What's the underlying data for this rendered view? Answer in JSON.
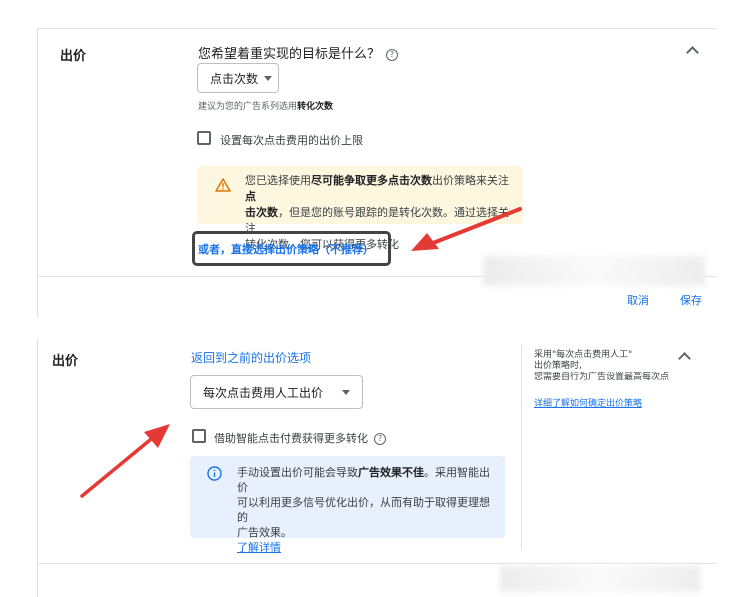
{
  "top": {
    "section_title": "出价",
    "question": "您希望着重实现的目标是什么？",
    "dropdown_value": "点击次数",
    "hint_prefix": "建议为您的广告系列选用",
    "hint_bold": "转化次数",
    "checkbox_label": "设置每次点击费用的出价上限",
    "warning_line1_a": "您已选择使用",
    "warning_line1_b": "尽可能争取更多点击次数",
    "warning_line1_c": "出价策略来关注",
    "warning_line1_d": "点",
    "warning_line2_a": "击次数",
    "warning_line2_b": "，但是您的账号跟踪的是转化次数。通过选择关注",
    "warning_line3": "转化次数，您可以获得更多转化",
    "alt_link": "或者，直接选择出价策略（不推荐）",
    "cancel": "取消",
    "save": "保存"
  },
  "bottom": {
    "section_title": "出价",
    "back_link": "返回到之前的出价选项",
    "dropdown_value": "每次点击费用人工出价",
    "checkbox_label": "借助智能点击付费获得更多转化",
    "info_line1_a": "手动设置出价可能会导致",
    "info_line1_b": "广告效果不佳",
    "info_line1_c": "。采用智能出价",
    "info_line2": "可以利用更多信号优化出价，从而有助于取得更理想的",
    "info_line3": "广告效果。",
    "info_link": "了解详情",
    "side_line1": "采用\"每次点击费用人工\"",
    "side_line2": "出价策略时,",
    "side_line3": "您需要自行为广告设置最高每次点",
    "side_link": "详细了解如何确定出价策略"
  },
  "colors": {
    "accent": "#1a73e8",
    "arrow": "#e53935",
    "warning_bg": "#fef7e0",
    "info_bg": "#e8f0fe"
  }
}
